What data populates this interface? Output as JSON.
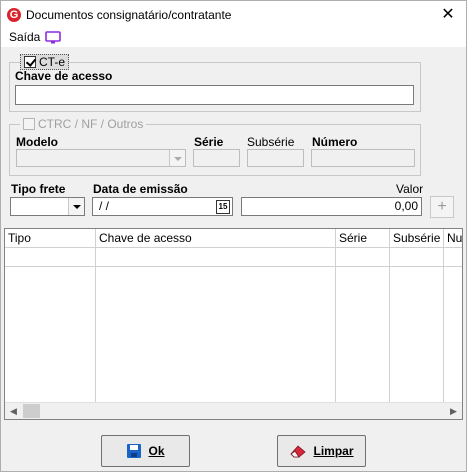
{
  "window": {
    "title": "Documentos consignatário/contratante",
    "close_glyph": "✕",
    "app_icon_letter": "G"
  },
  "menu": {
    "items": [
      "Saída"
    ],
    "screen_icon": "monitor-icon"
  },
  "cte_group": {
    "checkbox_label": "CT-e",
    "checked": true,
    "chave_label": "Chave de acesso",
    "chave_value": ""
  },
  "ctrc_group": {
    "checkbox_label": "CTRC / NF / Outros",
    "checked": false,
    "modelo_label": "Modelo",
    "serie_label": "Série",
    "subserie_label": "Subsérie",
    "numero_label": "Número"
  },
  "fields": {
    "tipo_frete_label": "Tipo frete",
    "tipo_frete_value": "",
    "data_emissao_label": "Data de emissão",
    "data_emissao_value": " /  /",
    "calendar_glyph": "15",
    "valor_label": "Valor",
    "valor_value": "0,00",
    "add_glyph": "+"
  },
  "grid": {
    "columns": [
      "Tipo",
      "Chave de acesso",
      "Série",
      "Subsérie",
      "Nu"
    ],
    "rows": [],
    "scroll_left": "◀",
    "scroll_right": "▶"
  },
  "buttons": {
    "ok": {
      "label": "Ok",
      "icon": "save-disk-icon"
    },
    "limpar": {
      "label": "Limpar",
      "icon": "eraser-icon"
    }
  },
  "colors": {
    "app_icon": "#d9232d",
    "menu_icon": "#8b2be2",
    "ok_icon": "#1a64c8",
    "limpar_icon": "#d8263a"
  }
}
